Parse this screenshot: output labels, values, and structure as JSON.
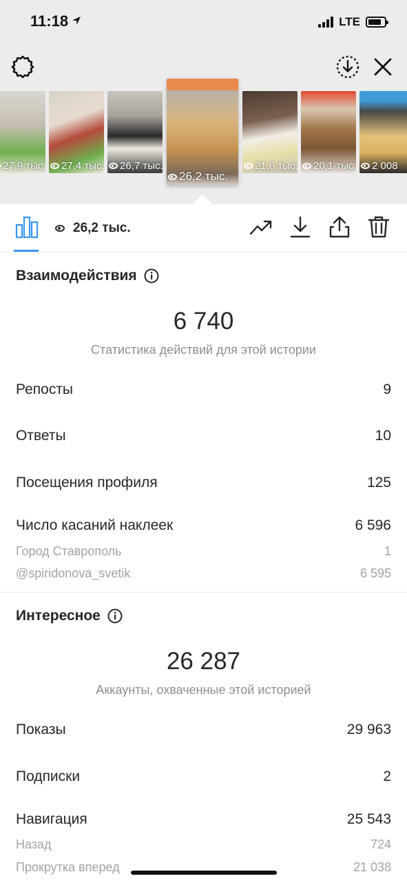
{
  "status_bar": {
    "time": "11:18",
    "network": "LTE"
  },
  "story_strip": {
    "thumbnails": [
      {
        "views": "27,9 тыс."
      },
      {
        "views": "27,4 тыс."
      },
      {
        "views": "26,7 тыс."
      },
      {
        "views": "26,2 тыс.",
        "active": true
      },
      {
        "views": "21,6 тыс."
      },
      {
        "views": "20,1 тыс."
      },
      {
        "views": "2 008"
      }
    ]
  },
  "actionbar": {
    "views": "26,2 тыс."
  },
  "interactions": {
    "title": "Взаимодействия",
    "total": "6 740",
    "caption": "Статистика действий для этой истории",
    "rows": [
      {
        "label": "Репосты",
        "value": "9"
      },
      {
        "label": "Ответы",
        "value": "10"
      },
      {
        "label": "Посещения профиля",
        "value": "125"
      },
      {
        "label": "Число касаний наклеек",
        "value": "6 596"
      }
    ],
    "subrows": [
      {
        "label": "Город Ставрополь",
        "value": "1"
      },
      {
        "label": "@spiridonova_svetik",
        "value": "6 595"
      }
    ]
  },
  "discovery": {
    "title": "Интересное",
    "total": "26 287",
    "caption": "Аккаунты, охваченные этой историей",
    "rows": [
      {
        "label": "Показы",
        "value": "29 963"
      },
      {
        "label": "Подписки",
        "value": "2"
      },
      {
        "label": "Навигация",
        "value": "25 543"
      }
    ],
    "subrows": [
      {
        "label": "Назад",
        "value": "724"
      },
      {
        "label": "Прокрутка вперед",
        "value": "21 038"
      }
    ]
  }
}
